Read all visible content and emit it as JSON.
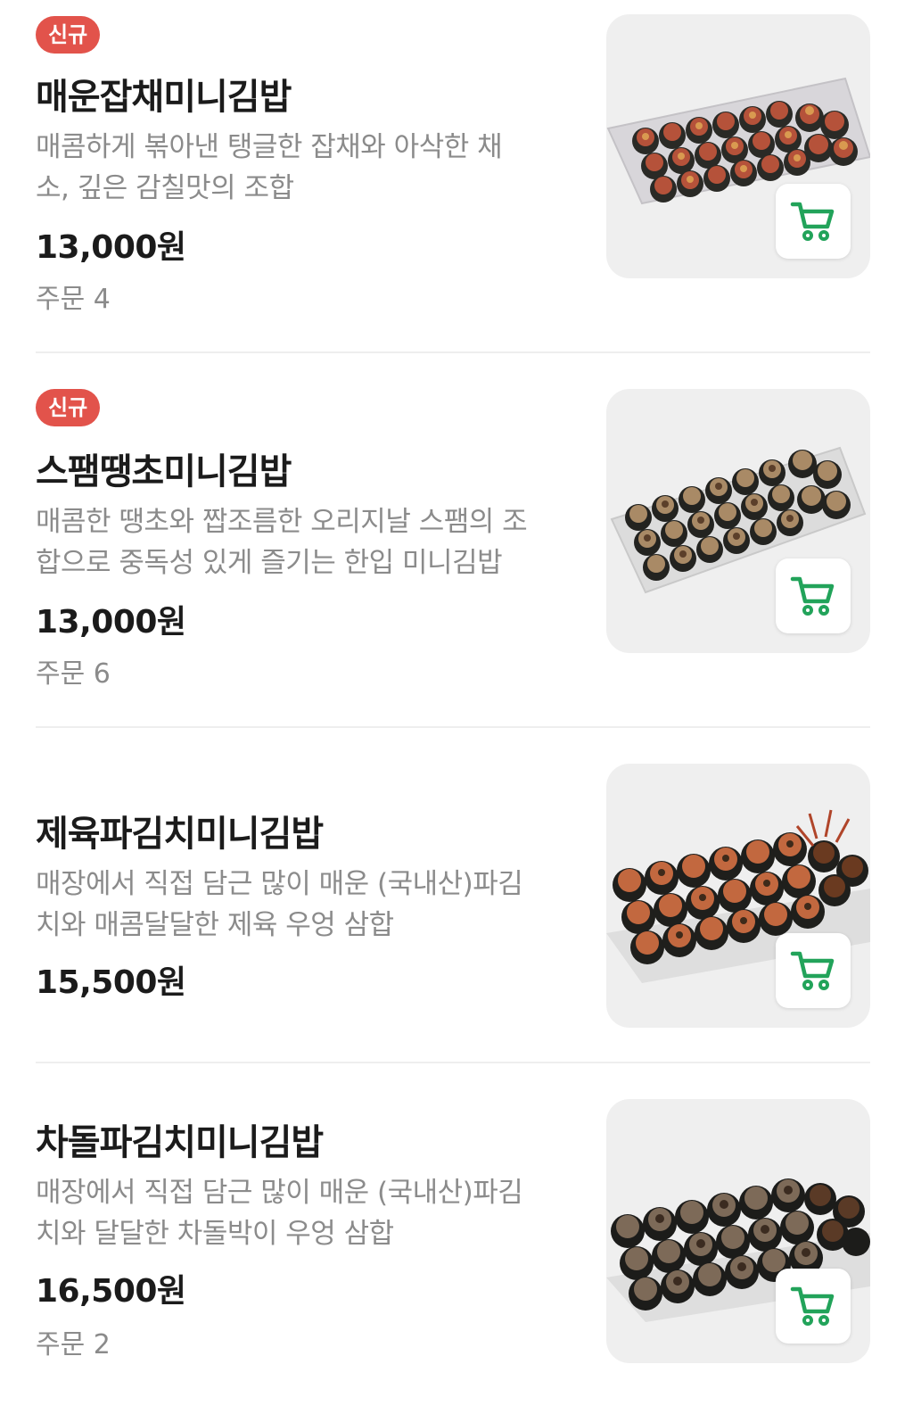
{
  "menu": {
    "items": [
      {
        "badge": "신규",
        "name": "매운잡채미니김밥",
        "desc_line1": "매콤하게 볶아낸 탱글한 잡채와 아삭한 채",
        "desc_line2": "소, 깊은 감칠맛의 조합",
        "price": "13,000원",
        "orders": "주문 4",
        "image_icon": "kimbap-platter-image",
        "cart_icon": "cart-icon"
      },
      {
        "badge": "신규",
        "name": "스팸땡초미니김밥",
        "desc_line1": "매콤한 땡초와 짭조름한 오리지날 스팸의 조",
        "desc_line2": "합으로 중독성 있게 즐기는 한입 미니김밥",
        "price": "13,000원",
        "orders": "주문 6",
        "image_icon": "kimbap-platter-image",
        "cart_icon": "cart-icon"
      },
      {
        "name": "제육파김치미니김밥",
        "desc_line1": "매장에서 직접 담근 많이 매운 (국내산)파김",
        "desc_line2": "치와 매콤달달한 제육 우엉 삼합",
        "price": "15,500원",
        "image_icon": "kimbap-platter-image",
        "cart_icon": "cart-icon"
      },
      {
        "name": "차돌파김치미니김밥",
        "desc_line1": "매장에서 직접 담근 많이 매운 (국내산)파김",
        "desc_line2": "치와 달달한 차돌박이 우엉 삼합",
        "price": "16,500원",
        "orders": "주문 2",
        "image_icon": "kimbap-platter-image",
        "cart_icon": "cart-icon"
      }
    ]
  },
  "colors": {
    "badge_bg": "#e2534b",
    "cart_green": "#22a35a",
    "muted_text": "#8b8b8b",
    "thumb_bg": "#efefef"
  }
}
